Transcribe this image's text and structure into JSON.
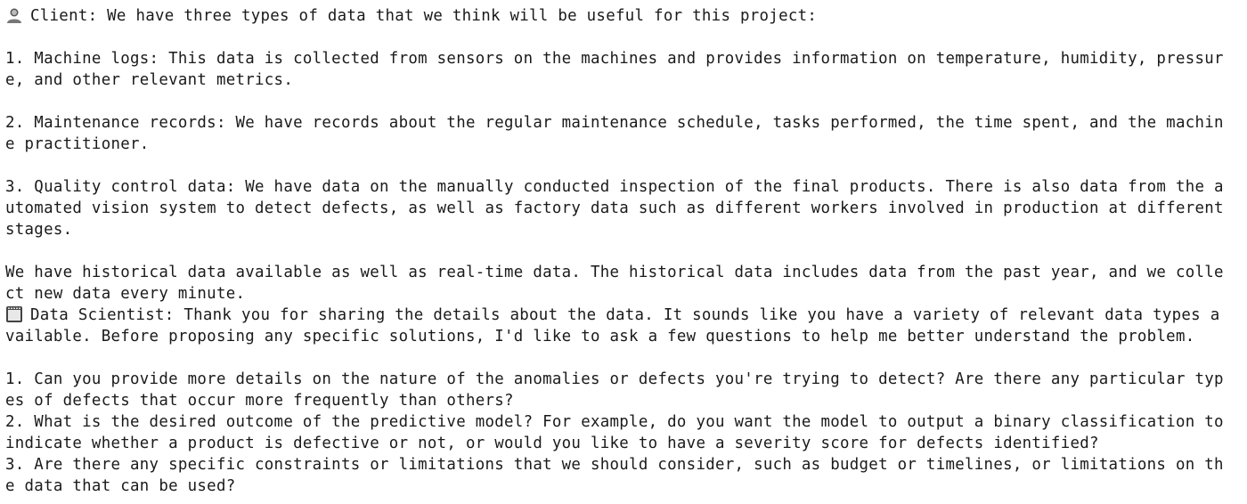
{
  "messages": [
    {
      "speaker": "Client",
      "icon": "person-icon",
      "lines": [
        "Client: We have three types of data that we think will be useful for this project:",
        "",
        "1. Machine logs: This data is collected from sensors on the machines and provides information on temperature, humidity, pressur",
        "e, and other relevant metrics.",
        "",
        "2. Maintenance records: We have records about the regular maintenance schedule, tasks performed, the time spent, and the machin",
        "e practitioner.",
        "",
        "3. Quality control data: We have data on the manually conducted inspection of the final products. There is also data from the a",
        "utomated vision system to detect defects, as well as factory data such as different workers involved in production at different",
        "stages.",
        "",
        "We have historical data available as well as real-time data. The historical data includes data from the past year, and we colle",
        "ct new data every minute."
      ]
    },
    {
      "speaker": "Data Scientist",
      "icon": "computer-icon",
      "lines": [
        "Data Scientist: Thank you for sharing the details about the data. It sounds like you have a variety of relevant data types a",
        "vailable. Before proposing any specific solutions, I'd like to ask a few questions to help me better understand the problem.",
        "",
        "1. Can you provide more details on the nature of the anomalies or defects you're trying to detect? Are there any particular typ",
        "es of defects that occur more frequently than others?",
        "2. What is the desired outcome of the predictive model? For example, do you want the model to output a binary classification to",
        "indicate whether a product is defective or not, or would you like to have a severity score for defects identified?",
        "3. Are there any specific constraints or limitations that we should consider, such as budget or timelines, or limitations on th",
        "e data that can be used?"
      ]
    }
  ]
}
